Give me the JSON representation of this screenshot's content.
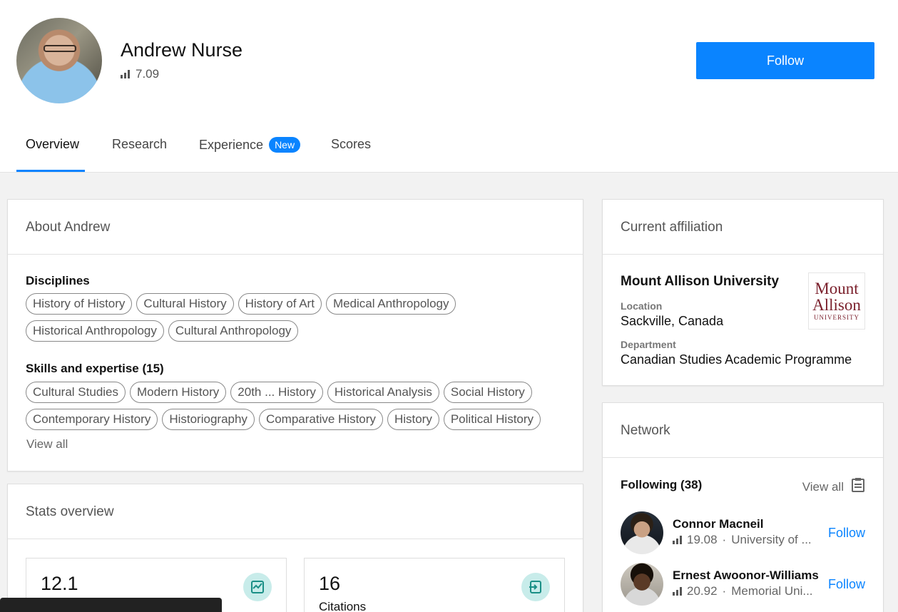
{
  "profile": {
    "name": "Andrew Nurse",
    "score": "7.09",
    "follow_label": "Follow"
  },
  "tabs": [
    {
      "label": "Overview",
      "active": true
    },
    {
      "label": "Research"
    },
    {
      "label": "Experience",
      "badge": "New"
    },
    {
      "label": "Scores"
    }
  ],
  "about": {
    "title": "About Andrew",
    "disciplines_label": "Disciplines",
    "disciplines": [
      "History of History",
      "Cultural History",
      "History of Art",
      "Medical Anthropology",
      "Historical Anthropology",
      "Cultural Anthropology"
    ],
    "skills_label": "Skills and expertise (15)",
    "skills": [
      "Cultural Studies",
      "Modern History",
      "20th ... History",
      "Historical Analysis",
      "Social History",
      "Contemporary History",
      "Historiography",
      "Comparative History",
      "History",
      "Political History"
    ],
    "view_all": "View all"
  },
  "stats": {
    "title": "Stats overview",
    "boxes": [
      {
        "value": "12.1",
        "label": "",
        "icon": "trend-icon"
      },
      {
        "value": "16",
        "label": "Citations",
        "icon": "citation-icon"
      }
    ]
  },
  "affiliation": {
    "title": "Current affiliation",
    "institution": "Mount Allison University",
    "location_label": "Location",
    "location": "Sackville, Canada",
    "department_label": "Department",
    "department": "Canadian Studies Academic Programme",
    "logo_line1": "Mount",
    "logo_line2": "Allison",
    "logo_line3": "UNIVERSITY"
  },
  "network": {
    "title": "Network",
    "following_label": "Following (38)",
    "view_all": "View all",
    "people": [
      {
        "name": "Connor Macneil",
        "score": "19.08",
        "affiliation": "University of ...",
        "follow": "Follow"
      },
      {
        "name": "Ernest Awoonor-Williams",
        "score": "20.92",
        "affiliation": "Memorial Uni...",
        "follow": "Follow"
      }
    ]
  },
  "colors": {
    "accent": "#0a84ff",
    "stat_icon_bg": "#c8ecea",
    "stat_icon_fg": "#1a8f86",
    "logo": "#7a1f2b"
  }
}
